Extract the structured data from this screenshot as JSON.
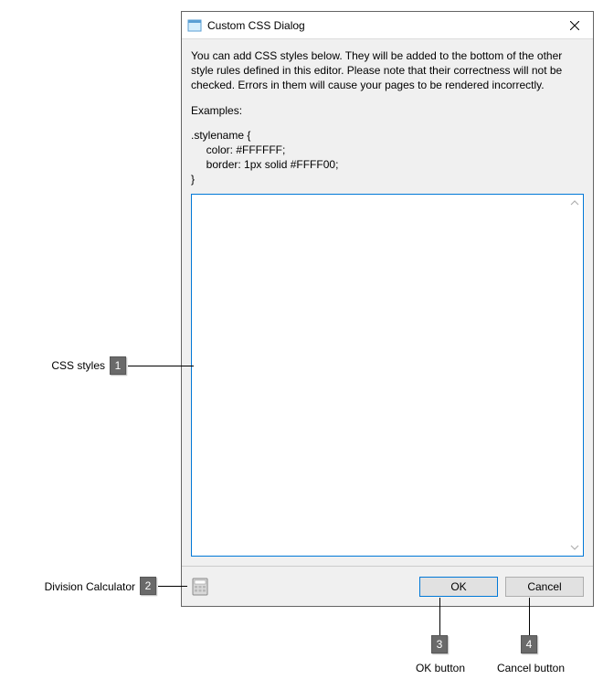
{
  "dialog": {
    "title": "Custom CSS Dialog",
    "intro": "You can add CSS styles below. They will be added to the bottom of the other style rules defined in this editor. Please note that their correctness will not be checked. Errors in them will cause your pages to be rendered incorrectly.",
    "examples_label": "Examples:",
    "example_code": ".stylename {\n     color: #FFFFFF;\n     border: 1px solid #FFFF00;\n}",
    "textarea_value": "",
    "ok_label": "OK",
    "cancel_label": "Cancel"
  },
  "callouts": {
    "c1": {
      "num": "1",
      "label": "CSS styles"
    },
    "c2": {
      "num": "2",
      "label": "Division Calculator"
    },
    "c3": {
      "num": "3",
      "label": "OK button"
    },
    "c4": {
      "num": "4",
      "label": "Cancel button"
    }
  }
}
